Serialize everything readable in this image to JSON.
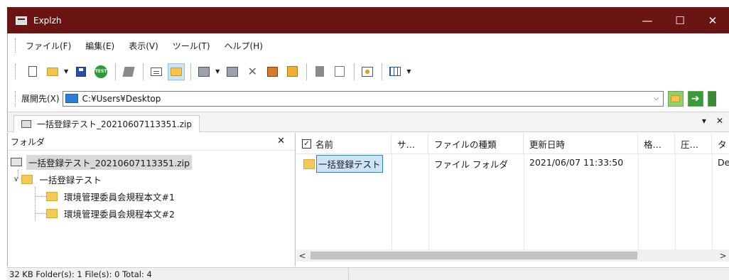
{
  "window": {
    "title": "Explzh",
    "controls": {
      "minimize": "—",
      "maximize": "☐",
      "close": "✕"
    }
  },
  "menu": {
    "items": [
      "ファイル(F)",
      "編集(E)",
      "表示(V)",
      "ツール(T)",
      "ヘルプ(H)"
    ]
  },
  "toolbar": {
    "test_label": "TEST"
  },
  "address": {
    "label": "展開先(X)",
    "value": "C:¥Users¥Desktop"
  },
  "tabs": {
    "active": "一括登録テスト_20210607113351.zip",
    "menu_glyph": "▾",
    "close_glyph": "✕"
  },
  "folder_panel": {
    "title": "フォルダ",
    "close_glyph": "✕",
    "tree": [
      {
        "label": "一括登録テスト_20210607113351.zip",
        "icon": "zip-icon",
        "selected": true
      },
      {
        "label": "一括登録テスト",
        "icon": "folder-icon",
        "expanded": true
      },
      {
        "label": "環境管理委員会規程本文#1",
        "icon": "folder-icon"
      },
      {
        "label": "環境管理委員会規程本文#2",
        "icon": "folder-icon"
      }
    ]
  },
  "file_list": {
    "columns": [
      "名前",
      "サ…",
      "ファイルの種類",
      "更新日時",
      "格…",
      "圧…",
      "タ"
    ],
    "rows": [
      {
        "name": "一括登録テスト",
        "size": "",
        "type": "ファイル フォルダ",
        "modified": "2021/06/07 11:33:50",
        "c5": "",
        "c6": "",
        "c7": "De"
      }
    ],
    "scroll_left_glyph": "<",
    "scroll_right_glyph": ">"
  },
  "status": {
    "text": "32 KB  Folder(s): 1  File(s): 0  Total: 4"
  }
}
